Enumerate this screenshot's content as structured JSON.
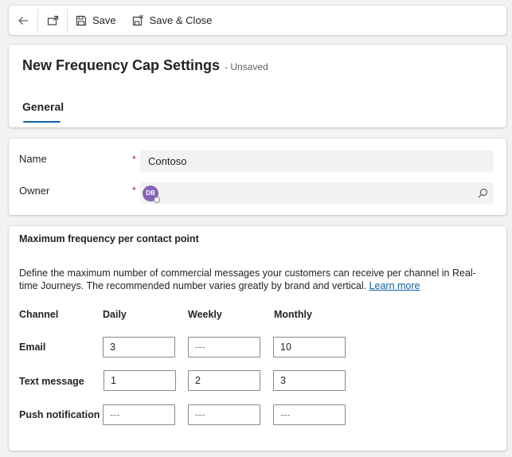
{
  "toolbar": {
    "back_icon": "arrow-left-icon",
    "popout_icon": "open-in-new-window-icon",
    "save_label": "Save",
    "save_close_label": "Save & Close"
  },
  "header": {
    "title": "New Frequency Cap Settings",
    "status": "- Unsaved",
    "tabs": [
      {
        "label": "General",
        "active": true
      }
    ]
  },
  "form": {
    "name_label": "Name",
    "name_value": "Contoso",
    "owner_label": "Owner",
    "owner_avatar_initials": "DB",
    "owner_avatar_color": "#8764b8"
  },
  "frequency": {
    "title": "Maximum frequency per contact point",
    "description": "Define the maximum number of commercial messages your customers can receive per channel in Real-time Journeys. The recommended number varies greatly by brand and vertical.",
    "learn_more": "Learn more",
    "columns": [
      "Channel",
      "Daily",
      "Weekly",
      "Monthly"
    ],
    "rows": [
      {
        "channel": "Email",
        "daily": "3",
        "weekly": "---",
        "monthly": "10"
      },
      {
        "channel": "Text message",
        "daily": "1",
        "weekly": "2",
        "monthly": "3"
      },
      {
        "channel": "Push notification",
        "daily": "---",
        "weekly": "---",
        "monthly": "---"
      }
    ]
  },
  "colors": {
    "accent": "#115ea3",
    "required": "#c50f1f"
  }
}
